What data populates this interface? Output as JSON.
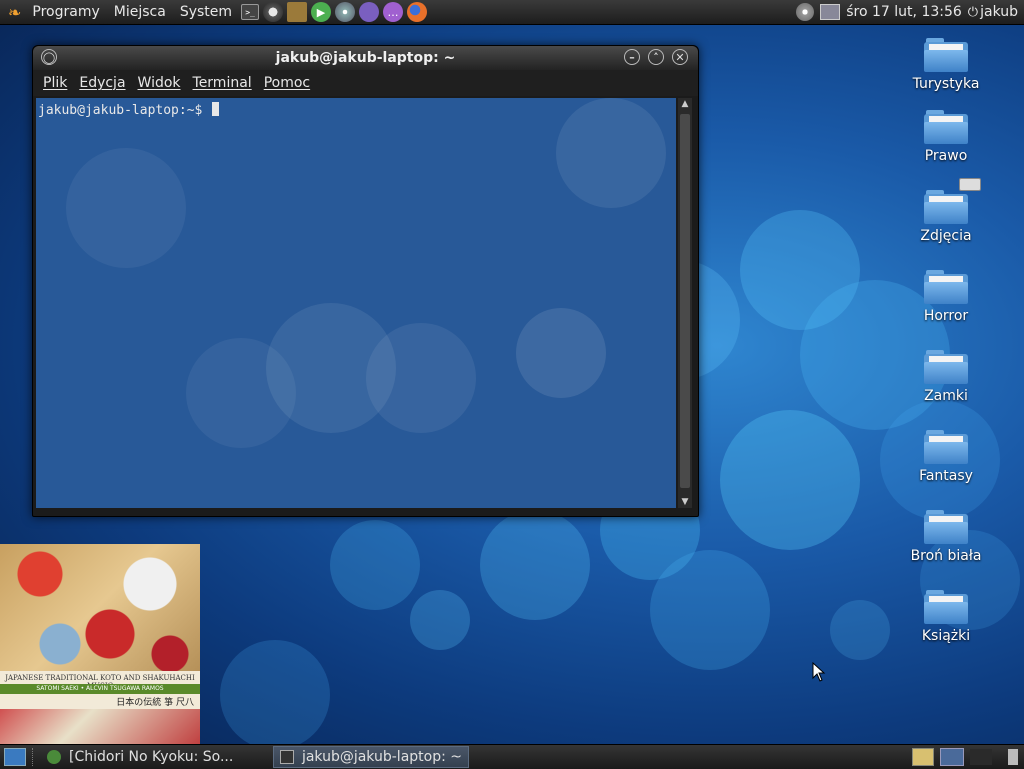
{
  "top_panel": {
    "menus": [
      "Programy",
      "Miejsca",
      "System"
    ],
    "clock": "śro 17 lut, 13:56",
    "user": "jakub"
  },
  "terminal": {
    "title": "jakub@jakub-laptop: ~",
    "menu": [
      "Plik",
      "Edycja",
      "Widok",
      "Terminal",
      "Pomoc"
    ],
    "prompt": "jakub@jakub-laptop:~$"
  },
  "desktop_icons": [
    "Turystyka",
    "Prawo",
    "Zdjęcia",
    "Horror",
    "Zamki",
    "Fantasy",
    "Broń biała",
    "Książki"
  ],
  "album": {
    "line1": "JAPANESE TRADITIONAL KOTO AND SHAKUHACHI MUSIC",
    "line2": "SATOMI SAEKI • ALCVIN TSUGAWA RAMOS",
    "line3": "日本の伝統 箏 尺八"
  },
  "taskbar": {
    "items": [
      "[Chidori No Kyoku: So...",
      "jakub@jakub-laptop: ~"
    ]
  }
}
